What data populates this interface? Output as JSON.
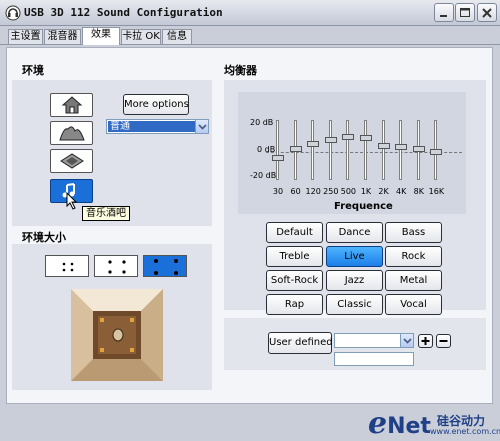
{
  "window": {
    "title": "USB 3D 112 Sound Configuration"
  },
  "tabs": [
    {
      "label": "主设置"
    },
    {
      "label": "混音器"
    },
    {
      "label": "效果"
    },
    {
      "label": "卡拉 OK"
    },
    {
      "label": "信息"
    }
  ],
  "active_tab": "效果",
  "environment": {
    "title": "环境",
    "more_options_label": "More options",
    "selected_environment": "普通",
    "tooltip": "音乐酒吧",
    "buttons": [
      {
        "icon": "house-icon"
      },
      {
        "icon": "opera-house-icon"
      },
      {
        "icon": "stone-room-icon"
      },
      {
        "icon": "music-bar-icon"
      }
    ],
    "selected_index": 3
  },
  "environment_size": {
    "title": "环境大小",
    "options": [
      "small",
      "medium",
      "large"
    ],
    "selected_index": 2
  },
  "equalizer": {
    "title": "均衡器",
    "db_labels": [
      "20 dB",
      "0 dB",
      "-20 dB"
    ],
    "axis_label": "Frequence",
    "bands": [
      {
        "freq": "30",
        "level_db": -5
      },
      {
        "freq": "60",
        "level_db": 1
      },
      {
        "freq": "120",
        "level_db": 4
      },
      {
        "freq": "250",
        "level_db": 7
      },
      {
        "freq": "500",
        "level_db": 9
      },
      {
        "freq": "1K",
        "level_db": 8
      },
      {
        "freq": "2K",
        "level_db": 3
      },
      {
        "freq": "4K",
        "level_db": 2
      },
      {
        "freq": "8K",
        "level_db": 1
      },
      {
        "freq": "16K",
        "level_db": -1
      }
    ],
    "presets": [
      "Default",
      "Dance",
      "Bass",
      "Treble",
      "Live",
      "Rock",
      "Soft-Rock",
      "Jazz",
      "Metal",
      "Rap",
      "Classic",
      "Vocal"
    ],
    "selected_preset": "Live",
    "user_defined_label": "User defined",
    "user_defined_value": "",
    "user_name_value": ""
  },
  "footer": {
    "brand_e": "e",
    "brand_net": "Net",
    "brand_cn": "硅谷动力",
    "brand_url": "www.enet.com.cn"
  },
  "colors": {
    "accent": "#1a6fd8",
    "panel": "#dfe2ea",
    "background": "#f4f5f8"
  }
}
